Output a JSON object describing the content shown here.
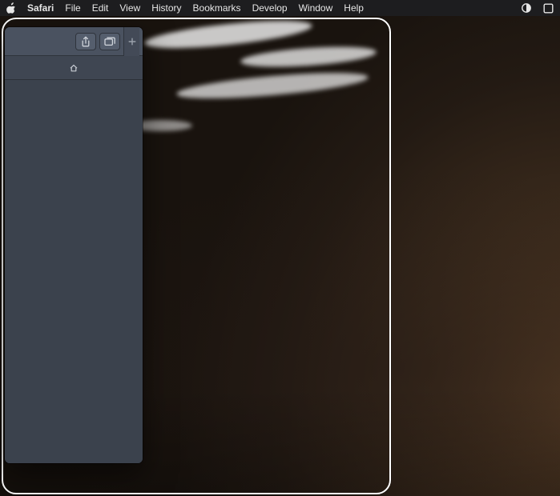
{
  "menubar": {
    "app_name": "Safari",
    "items": [
      "File",
      "Edit",
      "View",
      "History",
      "Bookmarks",
      "Develop",
      "Window",
      "Help"
    ]
  },
  "safari": {
    "toolbar": {
      "share_label": "Share",
      "tabs_overview_label": "Show Tab Overview",
      "new_tab_label": "New Tab"
    },
    "tabs": [
      {
        "title": ""
      }
    ]
  }
}
